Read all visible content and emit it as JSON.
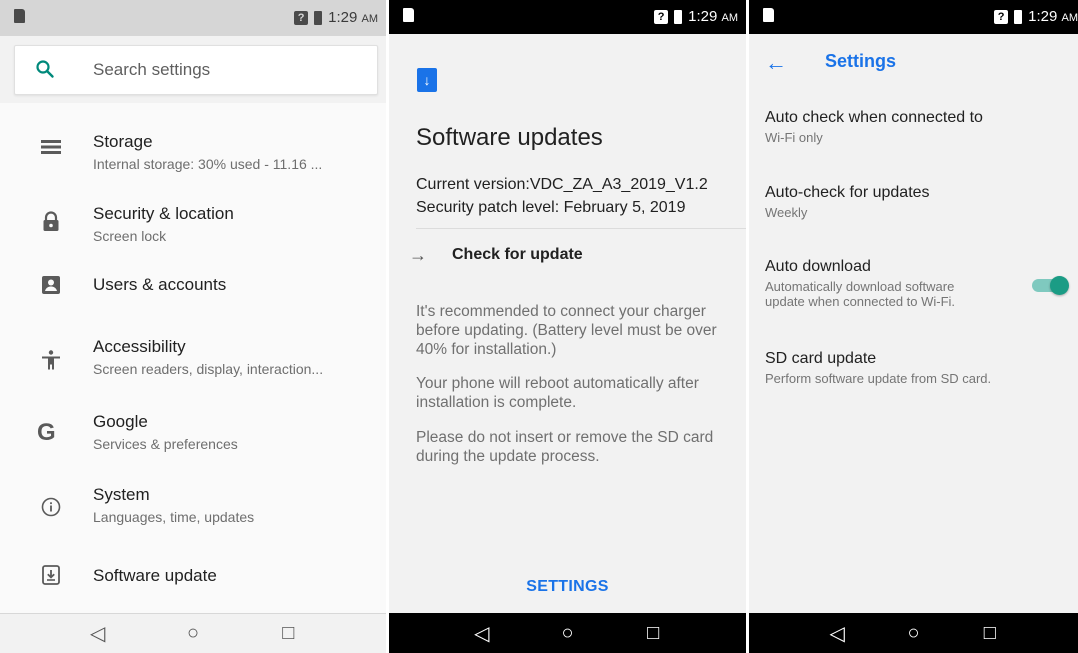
{
  "status_bar": {
    "time": "1:29",
    "ampm": "AM"
  },
  "settings_home": {
    "search_placeholder": "Search settings",
    "items": [
      {
        "title": "Storage",
        "subtitle": "Internal storage: 30% used - 11.16 ...",
        "icon": "storage-icon"
      },
      {
        "title": "Security & location",
        "subtitle": "Screen lock",
        "icon": "lock-icon"
      },
      {
        "title": "Users & accounts",
        "subtitle": "",
        "icon": "account-box-icon"
      },
      {
        "title": "Accessibility",
        "subtitle": "Screen readers, display, interaction...",
        "icon": "accessibility-icon"
      },
      {
        "title": "Google",
        "subtitle": "Services & preferences",
        "icon": "google-icon"
      },
      {
        "title": "System",
        "subtitle": "Languages, time, updates",
        "icon": "info-icon"
      },
      {
        "title": "Software update",
        "subtitle": "",
        "icon": "system-update-icon"
      }
    ]
  },
  "software_updates": {
    "title": "Software updates",
    "current_version": "Current version:VDC_ZA_A3_2019_V1.2",
    "security_patch": "Security patch level: February 5, 2019",
    "check_label": "Check for update",
    "notes": [
      "It's recommended to connect your charger before updating. (Battery level must be over 40% for installation.)",
      "Your phone will reboot automatically after installation is complete.",
      "Please do not insert or remove the SD card during the update process."
    ],
    "settings_button": "SETTINGS"
  },
  "update_settings": {
    "title": "Settings",
    "prefs": [
      {
        "title": "Auto check when connected to",
        "subtitle": "Wi-Fi only"
      },
      {
        "title": "Auto-check for updates",
        "subtitle": "Weekly"
      },
      {
        "title": "Auto download",
        "subtitle": "Automatically download software update when connected to Wi-Fi.",
        "toggle_on": true
      },
      {
        "title": "SD card update",
        "subtitle": "Perform software update from SD card."
      }
    ]
  },
  "nav": {
    "back": "◁",
    "home": "○",
    "recents": "□"
  },
  "colors": {
    "accent": "#1a73e8",
    "toggle": "#1b9c85",
    "search_icon": "#00897b"
  }
}
